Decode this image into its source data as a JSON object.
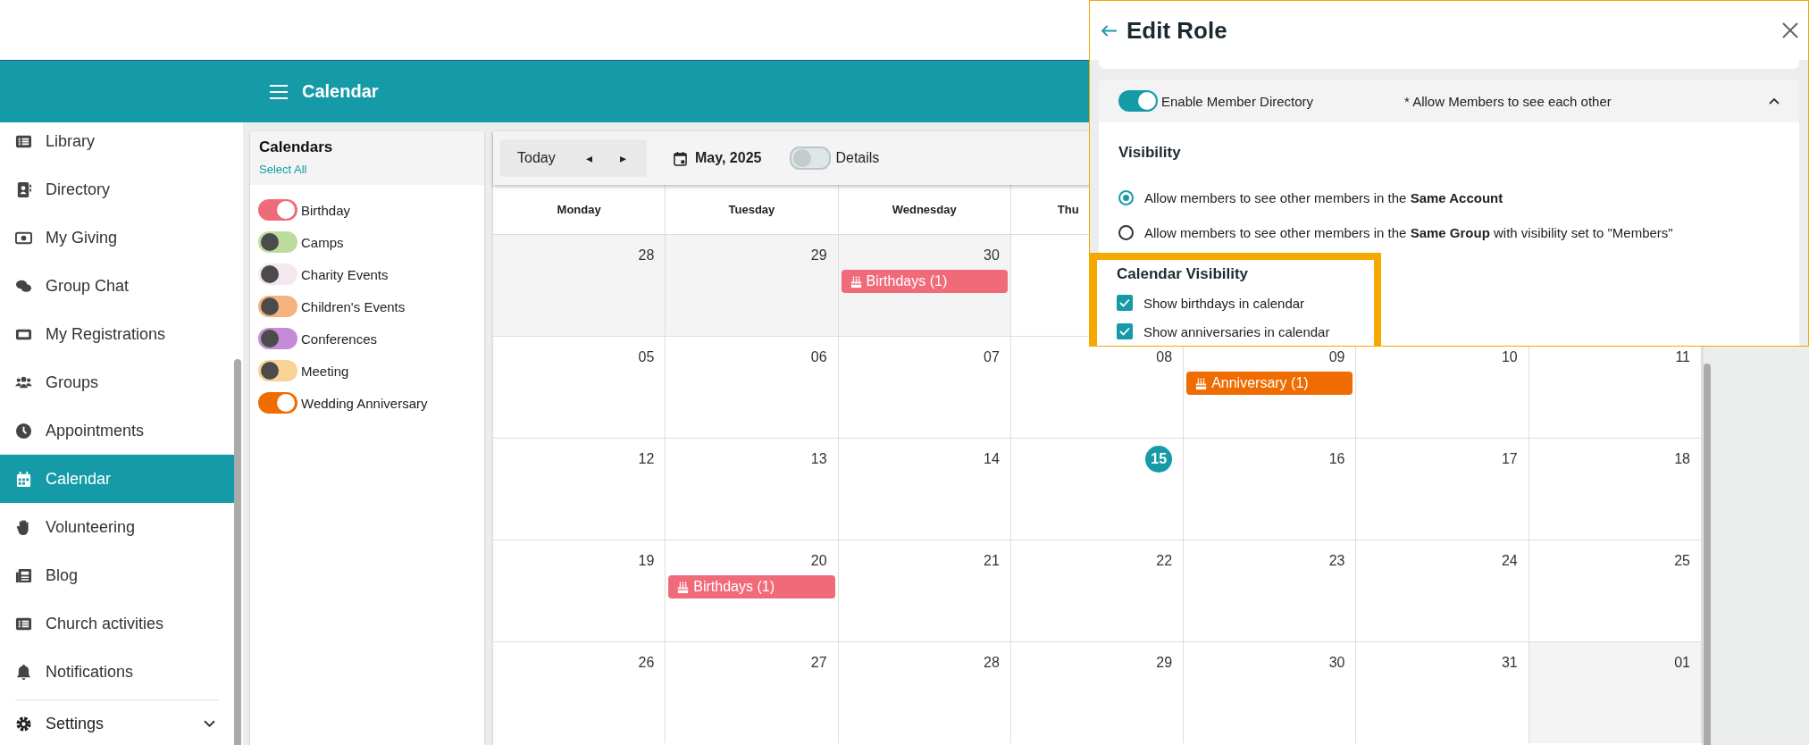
{
  "header": {
    "title": "Calendar"
  },
  "sidebar": {
    "items": [
      {
        "label": "Library",
        "selected": false
      },
      {
        "label": "Directory",
        "selected": false
      },
      {
        "label": "My Giving",
        "selected": false
      },
      {
        "label": "Group Chat",
        "selected": false
      },
      {
        "label": "My Registrations",
        "selected": false
      },
      {
        "label": "Groups",
        "selected": false
      },
      {
        "label": "Appointments",
        "selected": false
      },
      {
        "label": "Calendar",
        "selected": true
      },
      {
        "label": "Volunteering",
        "selected": false
      },
      {
        "label": "Blog",
        "selected": false
      },
      {
        "label": "Church activities",
        "selected": false
      },
      {
        "label": "Notifications",
        "selected": false
      }
    ],
    "settings": {
      "label": "Settings",
      "expanded": false
    }
  },
  "calendars": {
    "title": "Calendars",
    "select_all": "Select All",
    "items": [
      {
        "label": "Birthday",
        "color": "#f06b7a",
        "on": true
      },
      {
        "label": "Camps",
        "color": "#bcdc9e",
        "on": false
      },
      {
        "label": "Charity Events",
        "color": "#f4e8f0",
        "on": false
      },
      {
        "label": "Children's Events",
        "color": "#f4b27d",
        "on": false
      },
      {
        "label": "Conferences",
        "color": "#c68bd6",
        "on": false
      },
      {
        "label": "Meeting",
        "color": "#f9d394",
        "on": false
      },
      {
        "label": "Wedding Anniversary",
        "color": "#ef6c00",
        "on": true
      }
    ]
  },
  "toolbar": {
    "today": "Today",
    "prev": "◂",
    "next": "▸",
    "month": "May, 2025",
    "details": {
      "label": "Details",
      "on": false
    }
  },
  "weekdays": [
    "Monday",
    "Tuesday",
    "Wednesday",
    "Thu"
  ],
  "weeks": [
    {
      "cells": [
        {
          "day": "28",
          "outside": true
        },
        {
          "day": "29",
          "outside": true
        },
        {
          "day": "30",
          "outside": true,
          "events": [
            {
              "label": "Birthdays (1)",
              "color": "#f06b7a"
            }
          ]
        }
      ]
    },
    {
      "cells": [
        {
          "day": "05"
        },
        {
          "day": "06"
        },
        {
          "day": "07"
        },
        {
          "day": "08"
        },
        {
          "day": "09",
          "events": [
            {
              "label": "Anniversary (1)",
              "color": "#ef6c00"
            }
          ]
        },
        {
          "day": "10"
        },
        {
          "day": "11"
        }
      ]
    },
    {
      "cells": [
        {
          "day": "12"
        },
        {
          "day": "13"
        },
        {
          "day": "14"
        },
        {
          "day": "15",
          "today": true
        },
        {
          "day": "16"
        },
        {
          "day": "17"
        },
        {
          "day": "18"
        }
      ]
    },
    {
      "cells": [
        {
          "day": "19"
        },
        {
          "day": "20",
          "events": [
            {
              "label": "Birthdays (1)",
              "color": "#f06b7a"
            }
          ]
        },
        {
          "day": "21"
        },
        {
          "day": "22"
        },
        {
          "day": "23"
        },
        {
          "day": "24"
        },
        {
          "day": "25"
        }
      ]
    },
    {
      "cells": [
        {
          "day": "26"
        },
        {
          "day": "27"
        },
        {
          "day": "28"
        },
        {
          "day": "29"
        },
        {
          "day": "30"
        },
        {
          "day": "31"
        },
        {
          "day": "01",
          "outside": true
        }
      ]
    }
  ],
  "edit_role": {
    "title": "Edit Role",
    "member_directory": {
      "label": "Enable Member Directory",
      "on": true,
      "note": "* Allow Members to see each other",
      "expanded": true
    },
    "visibility": {
      "heading": "Visibility",
      "options": [
        {
          "label": "Allow members to see other members in the **Same Account**",
          "selected": true
        },
        {
          "label": "Allow members to see other members in the **Same Group** with visibility set to \"Members\"",
          "selected": false
        }
      ]
    },
    "calendar_visibility": {
      "heading": "Calendar Visibility",
      "options": [
        {
          "label": "Show birthdays in calendar",
          "checked": true
        },
        {
          "label": "Show anniversaries in calendar",
          "checked": true
        }
      ]
    }
  }
}
